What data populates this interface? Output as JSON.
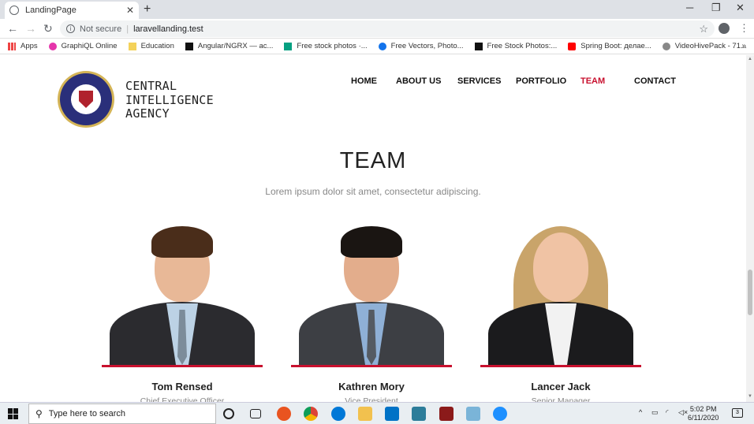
{
  "browser": {
    "tab_title": "LandingPage",
    "new_tab": "+",
    "win_min": "─",
    "win_max": "❐",
    "win_close": "✕",
    "not_secure": "Not secure",
    "url": "laravellanding.test",
    "bookmarks": [
      "Apps",
      "GraphiQL Online",
      "Education",
      "Angular/NGRX — ас...",
      "Free stock photos ·...",
      "Free Vectors, Photo...",
      "Free Stock Photos:...",
      "Spring Boot: делае...",
      "VideoHivePack - 71..."
    ]
  },
  "site": {
    "brand_lines": [
      "CENTRAL",
      "INTELLIGENCE",
      "AGENCY"
    ],
    "nav": [
      "HOME",
      "ABOUT US",
      "SERVICES",
      "PORTFOLIO",
      "TEAM",
      "CONTACT"
    ],
    "active_nav": "TEAM",
    "section_title": "TEAM",
    "section_subtitle": "Lorem ipsum dolor sit amet, consectetur adipiscing.",
    "team": [
      {
        "name": "Tom Rensed",
        "role": "Chief Executive Officer"
      },
      {
        "name": "Kathren Mory",
        "role": "Vice President"
      },
      {
        "name": "Lancer Jack",
        "role": "Senior Manager"
      }
    ],
    "accent_color": "#c8102e"
  },
  "taskbar": {
    "search_placeholder": "Type here to search",
    "time": "5:02 PM",
    "date": "6/11/2020",
    "notifications": "3"
  }
}
